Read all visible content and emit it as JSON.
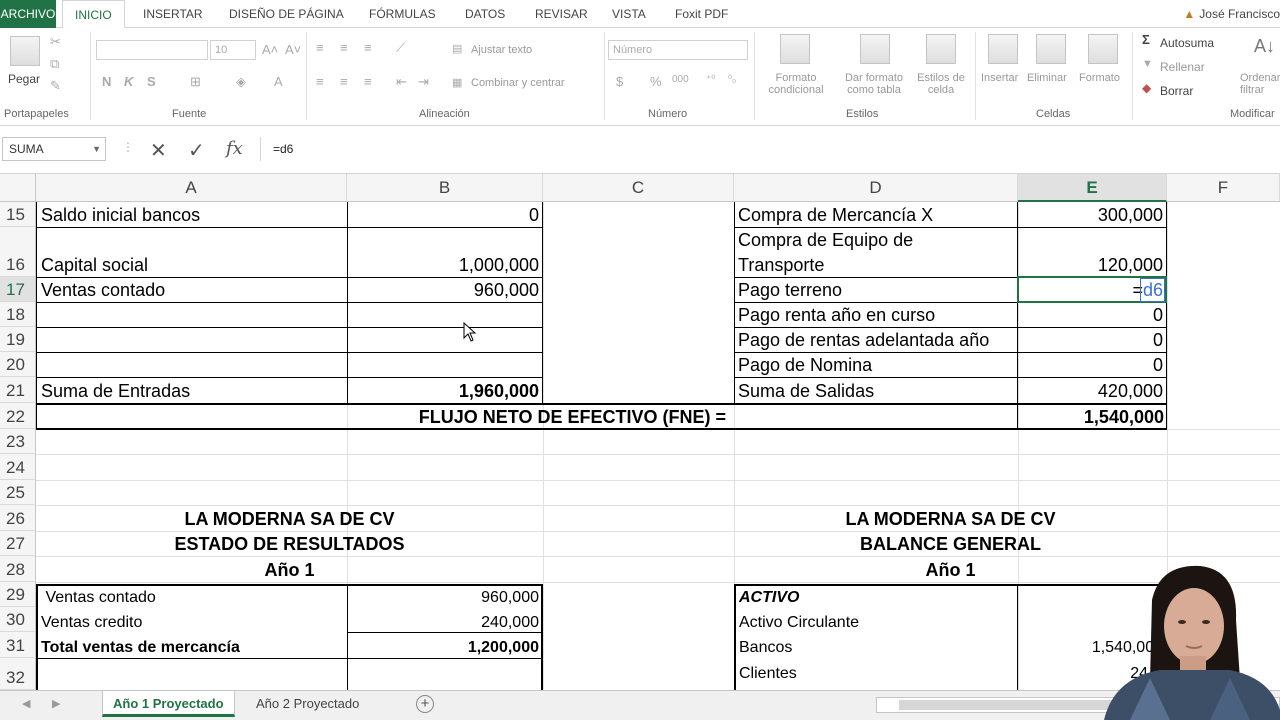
{
  "ribbon_tabs": [
    "ARCHIVO",
    "INICIO",
    "INSERTAR",
    "DISEÑO DE PÁGINA",
    "FÓRMULAS",
    "DATOS",
    "REVISAR",
    "VISTA",
    "Foxit PDF"
  ],
  "user_name": "José Francisco",
  "ribbon": {
    "paste": "Pegar",
    "font_name": "",
    "font_size": "10",
    "bold": "N",
    "italic": "K",
    "underline": "S",
    "wrap_text": "Ajustar texto",
    "merge_center": "Combinar y centrar",
    "number_format": "Número",
    "cond_format": "Formato condicional",
    "table_format": "Dar formato como tabla",
    "cell_styles": "Estilos de celda",
    "insert": "Insertar",
    "delete": "Eliminar",
    "format": "Formato",
    "autosum": "Autosuma",
    "fill": "Rellenar",
    "clear": "Borrar",
    "sort": "Ordenar y filtrar",
    "groups": [
      "Portapapeles",
      "Fuente",
      "Alineación",
      "Número",
      "Estilos",
      "Celdas",
      "Modificar"
    ]
  },
  "formula_bar": {
    "name_box": "SUMA",
    "cancel": "✕",
    "enter": "✓",
    "fx": "fx",
    "formula": "=d6"
  },
  "columns": [
    "A",
    "B",
    "C",
    "D",
    "E",
    "F"
  ],
  "rows": [
    "15",
    "16",
    "17",
    "18",
    "19",
    "20",
    "21",
    "22",
    "23",
    "24",
    "25",
    "26",
    "27",
    "28",
    "29",
    "30",
    "31",
    "32"
  ],
  "cells": {
    "a15": "Saldo inicial bancos",
    "b15": "0",
    "a16": "Capital social",
    "b16": "1,000,000",
    "a17": "Ventas contado",
    "b17": "960,000",
    "a21": "Suma de Entradas",
    "b21": "1,960,000",
    "fne_label": "FLUJO NETO DE EFECTIVO (FNE) =",
    "fne_value": "1,540,000",
    "d15": "Compra de Mercancía X",
    "e15": "300,000",
    "d16a": "Compra de Equipo de",
    "d16b": "Transporte",
    "e16": "120,000",
    "d17": "Pago terreno",
    "e17_eq": "=",
    "e17_ref": "d6",
    "d18": "Pago renta año en curso",
    "e18": "0",
    "d19": "Pago de rentas adelantada año",
    "e19": "0",
    "d20": "Pago de Nomina",
    "e20": "0",
    "d21": "Suma de Salidas",
    "e21": "420,000",
    "left_title1": "LA MODERNA SA DE CV",
    "left_title2": "ESTADO DE RESULTADOS",
    "left_title3": "Año 1",
    "right_title1": "LA MODERNA SA DE CV",
    "right_title2": "BALANCE GENERAL",
    "right_title3": "Año 1",
    "a29": " Ventas contado",
    "b29": "960,000",
    "a30": "Ventas credito",
    "b30": "240,000",
    "a31": "Total ventas de mercancía",
    "b31": "1,200,000",
    "d29": "ACTIVO",
    "d30": "Activo Circulante",
    "d31": "Bancos",
    "e31": "1,540,000",
    "d32": "Clientes",
    "e32": "24"
  },
  "sheets": [
    "Año 1 Proyectado",
    "Año 2 Proyectado"
  ],
  "colors": {
    "excel_green": "#217346",
    "ref_blue": "#3b6fd6"
  }
}
